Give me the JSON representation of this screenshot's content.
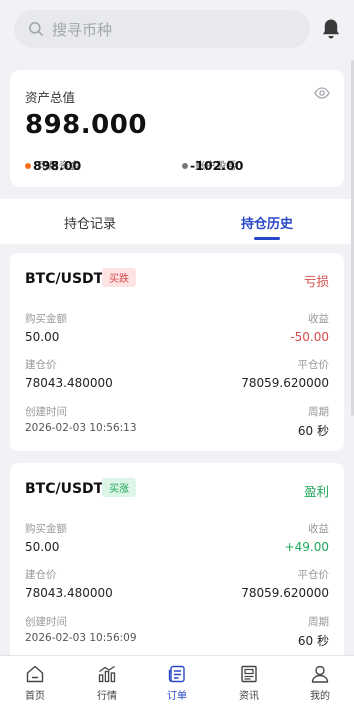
{
  "search": {
    "placeholder": "搜寻币种",
    "icon": "search-icon"
  },
  "header": {
    "notification_icon": "bell-icon"
  },
  "assets": {
    "title": "资产总值",
    "total": "898.000",
    "available_label": "可用资金",
    "available_value": "898.00",
    "pnl_label": "账户盈亏",
    "pnl_value": "-102.00",
    "available_dot_color": "#f26f1b",
    "pnl_dot_color": "#777777"
  },
  "tabs": [
    {
      "label": "持仓记录",
      "active": false
    },
    {
      "label": "持仓历史",
      "active": true
    }
  ],
  "orders": [
    {
      "pair": "BTC/USDT",
      "direction": "买跌",
      "direction_type": "down",
      "result": "亏损",
      "amount_label": "购买金额",
      "amount": "50.00",
      "profit_label": "收益",
      "profit": "-50.00",
      "open_label": "建仓价",
      "open_price": "78043.480000",
      "close_label": "平仓价",
      "close_price": "78059.620000",
      "time_label": "创建时间",
      "time": "2026-02-03 10:56:13",
      "period_label": "周期",
      "period": "60 秒"
    },
    {
      "pair": "BTC/USDT",
      "direction": "买涨",
      "direction_type": "up",
      "result": "盈利",
      "amount_label": "购买金额",
      "amount": "50.00",
      "profit_label": "收益",
      "profit": "+49.00",
      "open_label": "建仓价",
      "open_price": "78043.480000",
      "close_label": "平仓价",
      "close_price": "78059.620000",
      "time_label": "创建时间",
      "time": "2026-02-03 10:56:09",
      "period_label": "周期",
      "period": "60 秒"
    }
  ],
  "nav": [
    {
      "label": "首页",
      "icon": "home-icon",
      "active": false
    },
    {
      "label": "行情",
      "icon": "market-chart-icon",
      "active": false
    },
    {
      "label": "订单",
      "icon": "order-icon",
      "active": true
    },
    {
      "label": "资讯",
      "icon": "news-icon",
      "active": false
    },
    {
      "label": "我的",
      "icon": "user-icon",
      "active": false
    }
  ],
  "colors": {
    "accent": "#2948c9",
    "loss": "#d84b4b",
    "profit": "#1fa85a"
  }
}
